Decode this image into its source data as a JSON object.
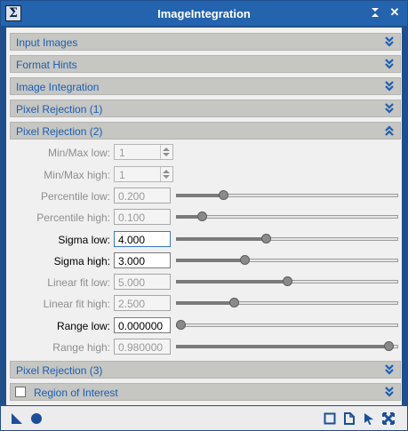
{
  "window": {
    "title": "ImageIntegration",
    "app_icon": "Σ",
    "shade_glyph": "⬍",
    "close_glyph": "✕"
  },
  "sections": {
    "input_images": "Input Images",
    "format_hints": "Format Hints",
    "image_integration": "Image Integration",
    "pixel_rejection_1": "Pixel Rejection (1)",
    "pixel_rejection_2": "Pixel Rejection (2)",
    "pixel_rejection_3": "Pixel Rejection (3)",
    "region_of_interest": "Region of Interest"
  },
  "pixel_rejection_2": {
    "minmax_low": {
      "label": "Min/Max low:",
      "value": "1"
    },
    "minmax_high": {
      "label": "Min/Max high:",
      "value": "1"
    },
    "percentile_low": {
      "label": "Percentile low:",
      "value": "0.200",
      "level": 0.2
    },
    "percentile_high": {
      "label": "Percentile high:",
      "value": "0.100",
      "level": 0.1
    },
    "sigma_low": {
      "label": "Sigma low:",
      "value": "4.000",
      "level": 0.4
    },
    "sigma_high": {
      "label": "Sigma high:",
      "value": "3.000",
      "level": 0.3
    },
    "linear_fit_low": {
      "label": "Linear fit low:",
      "value": "5.000",
      "level": 0.5
    },
    "linear_fit_high": {
      "label": "Linear fit high:",
      "value": "2.500",
      "level": 0.25
    },
    "range_low": {
      "label": "Range low:",
      "value": "0.000000",
      "level": 0.0
    },
    "range_high": {
      "label": "Range high:",
      "value": "0.980000",
      "level": 0.98
    }
  },
  "region_of_interest_checked": false,
  "colors": {
    "title_bar": "#2463ad",
    "section_text": "#1a5fb4",
    "section_bg": "#c6c6c2",
    "icon_blue": "#1a4f9c"
  },
  "icons": [
    "new-instance-icon",
    "apply-global-icon",
    "browse-documentation-icon",
    "edit-instance-icon",
    "apply-icon",
    "reset-icon"
  ]
}
